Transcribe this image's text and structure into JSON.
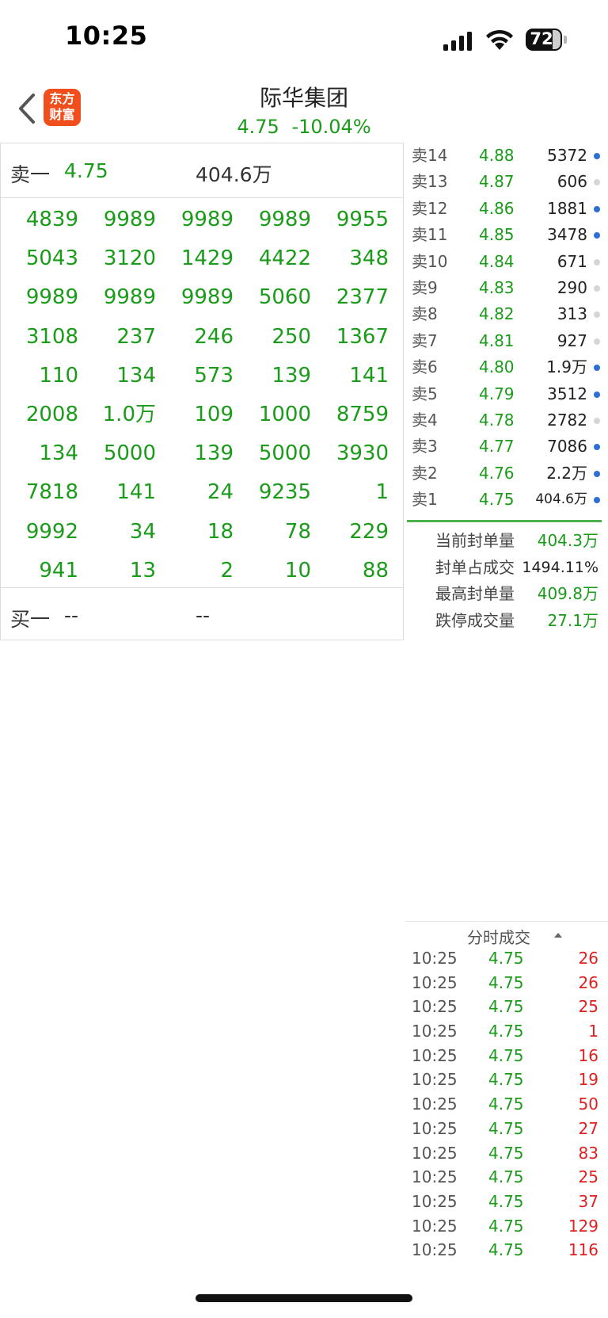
{
  "status_bar": {
    "time": "10:25",
    "battery": "72",
    "icons": [
      "cellular-signal-icon",
      "wifi-icon",
      "battery-icon"
    ]
  },
  "header": {
    "logo_line1": "东方",
    "logo_line2": "财富",
    "title": "际华集团",
    "price": "4.75",
    "change": "-10.04%"
  },
  "sell1": {
    "label": "卖一",
    "price": "4.75",
    "volume": "404.6万"
  },
  "buy1": {
    "label": "买一",
    "price": "--",
    "volume": "--"
  },
  "queue_grid": [
    [
      "4839",
      "9989",
      "9989",
      "9989",
      "9955"
    ],
    [
      "5043",
      "3120",
      "1429",
      "4422",
      "348"
    ],
    [
      "9989",
      "9989",
      "9989",
      "5060",
      "2377"
    ],
    [
      "3108",
      "237",
      "246",
      "250",
      "1367"
    ],
    [
      "110",
      "134",
      "573",
      "139",
      "141"
    ],
    [
      "2008",
      "1.0万",
      "109",
      "1000",
      "8759"
    ],
    [
      "134",
      "5000",
      "139",
      "5000",
      "3930"
    ],
    [
      "7818",
      "141",
      "24",
      "9235",
      "1"
    ],
    [
      "9992",
      "34",
      "18",
      "78",
      "229"
    ],
    [
      "941",
      "13",
      "2",
      "10",
      "88"
    ]
  ],
  "order_book": [
    {
      "label": "卖14",
      "price": "4.88",
      "volume": "5372",
      "dot": "blue"
    },
    {
      "label": "卖13",
      "price": "4.87",
      "volume": "606",
      "dot": "grey"
    },
    {
      "label": "卖12",
      "price": "4.86",
      "volume": "1881",
      "dot": "blue"
    },
    {
      "label": "卖11",
      "price": "4.85",
      "volume": "3478",
      "dot": "blue"
    },
    {
      "label": "卖10",
      "price": "4.84",
      "volume": "671",
      "dot": "grey"
    },
    {
      "label": "卖9",
      "price": "4.83",
      "volume": "290",
      "dot": "grey"
    },
    {
      "label": "卖8",
      "price": "4.82",
      "volume": "313",
      "dot": "grey"
    },
    {
      "label": "卖7",
      "price": "4.81",
      "volume": "927",
      "dot": "grey"
    },
    {
      "label": "卖6",
      "price": "4.80",
      "volume": "1.9万",
      "dot": "blue"
    },
    {
      "label": "卖5",
      "price": "4.79",
      "volume": "3512",
      "dot": "blue"
    },
    {
      "label": "卖4",
      "price": "4.78",
      "volume": "2782",
      "dot": "grey"
    },
    {
      "label": "卖3",
      "price": "4.77",
      "volume": "7086",
      "dot": "blue"
    },
    {
      "label": "卖2",
      "price": "4.76",
      "volume": "2.2万",
      "dot": "blue"
    },
    {
      "label": "卖1",
      "price": "4.75",
      "volume": "404.6万",
      "dot": "blue"
    }
  ],
  "stats": [
    {
      "label": "当前封单量",
      "value": "404.3万",
      "color": "green"
    },
    {
      "label": "封单占成交",
      "value": "1494.11%",
      "color": "dark"
    },
    {
      "label": "最高封单量",
      "value": "409.8万",
      "color": "green"
    },
    {
      "label": "跌停成交量",
      "value": "27.1万",
      "color": "green"
    }
  ],
  "ticks_title": "分时成交",
  "ticks": [
    {
      "time": "10:25",
      "price": "4.75",
      "volume": "26"
    },
    {
      "time": "10:25",
      "price": "4.75",
      "volume": "26"
    },
    {
      "time": "10:25",
      "price": "4.75",
      "volume": "25"
    },
    {
      "time": "10:25",
      "price": "4.75",
      "volume": "1"
    },
    {
      "time": "10:25",
      "price": "4.75",
      "volume": "16"
    },
    {
      "time": "10:25",
      "price": "4.75",
      "volume": "19"
    },
    {
      "time": "10:25",
      "price": "4.75",
      "volume": "50"
    },
    {
      "time": "10:25",
      "price": "4.75",
      "volume": "27"
    },
    {
      "time": "10:25",
      "price": "4.75",
      "volume": "83"
    },
    {
      "time": "10:25",
      "price": "4.75",
      "volume": "25"
    },
    {
      "time": "10:25",
      "price": "4.75",
      "volume": "37"
    },
    {
      "time": "10:25",
      "price": "4.75",
      "volume": "129"
    },
    {
      "time": "10:25",
      "price": "4.75",
      "volume": "116"
    }
  ],
  "colors": {
    "down_green": "#1a9b1a",
    "up_red": "#e02020",
    "accent_orange": "#f04e1c",
    "dot_blue": "#2f6fd3"
  }
}
